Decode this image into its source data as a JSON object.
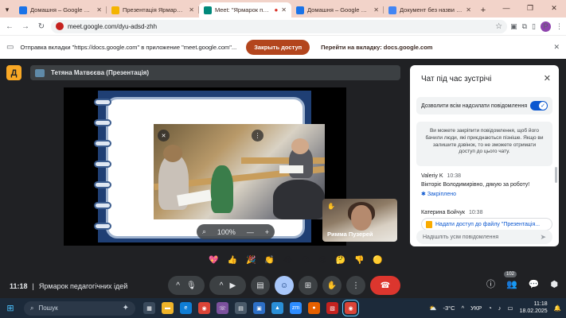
{
  "browser": {
    "tabs": [
      {
        "title": "Домашня – Google Диск",
        "favicon_color": "#1a73e8",
        "active": false
      },
      {
        "title": "Презентація Ярмарок п",
        "favicon_color": "#f4b400",
        "active": false
      },
      {
        "title": "Meet: \"Ярмарок педаго",
        "favicon_color": "#00897b",
        "active": true
      },
      {
        "title": "Домашня – Google Диск",
        "favicon_color": "#1a73e8",
        "active": false
      },
      {
        "title": "Документ без назви - Goo",
        "favicon_color": "#4285f4",
        "active": false
      }
    ],
    "url": "meet.google.com/dyu-adsd-zhh",
    "profile_letter": "P"
  },
  "infobar": {
    "message": "Отправка вкладки \"https://docs.google.com\" в приложение \"meet.google.com\"...",
    "share_button": "Закрыть доступ",
    "go_button": "Перейти на вкладку: docs.google.com"
  },
  "meet": {
    "presenter_label": "Тетяна Матвєєва (Презентація)",
    "zoom_level": "100%",
    "participant_name": "Римма Пузерей",
    "reactions": [
      "💖",
      "👍",
      "🎉",
      "👏",
      "😂",
      "😮",
      "😢",
      "🤔",
      "👎",
      "🟡"
    ],
    "time": "11:18",
    "meeting_title": "Ярмарок педагогічних ідей",
    "participants_count": "102"
  },
  "chat": {
    "title": "Чат під час зустрічі",
    "allow_label": "Дозволити всім надсилати повідомлення",
    "notice": "Ви можете закріпити повідомлення, щоб його бачили люди, які приєднаються пізніше. Якщо ви залишите дзвінок, то не зможете отримати доступ до цього чату.",
    "messages": [
      {
        "author": "Valeriy K",
        "time": "10:38",
        "text": "Вікторіє Володимирівно, дякую за роботу!",
        "pinned": "Закріплено"
      },
      {
        "author": "Катерина Бойчук",
        "time": "10:38",
        "file": "Надати доступ до файлу \"Презентація..."
      }
    ],
    "input_placeholder": "Надішліть усім повідомлення"
  },
  "taskbar": {
    "search_label": "Пошук",
    "weather": "-3°C",
    "lang": "УКР",
    "time": "11:18",
    "date": "18.02.2025"
  }
}
